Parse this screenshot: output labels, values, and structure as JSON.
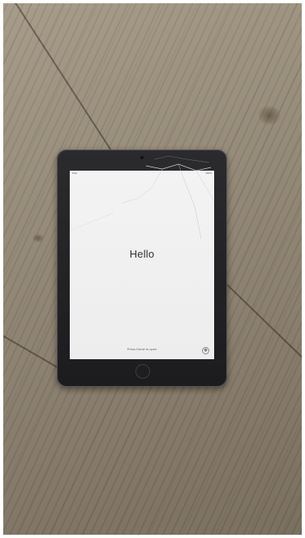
{
  "photo": {
    "subject_icon": "tablet-icon"
  },
  "screen": {
    "greeting": "Hello",
    "home_hint": "Press Home to open",
    "status_left": "iPad",
    "status_right": "100%",
    "accessibility_icon": "accessibility-icon"
  },
  "colors": {
    "floor": "#8f8472",
    "bezel": "#1c1c1f",
    "screen_bg": "#f0f0f0",
    "greeting_text": "#333333"
  }
}
